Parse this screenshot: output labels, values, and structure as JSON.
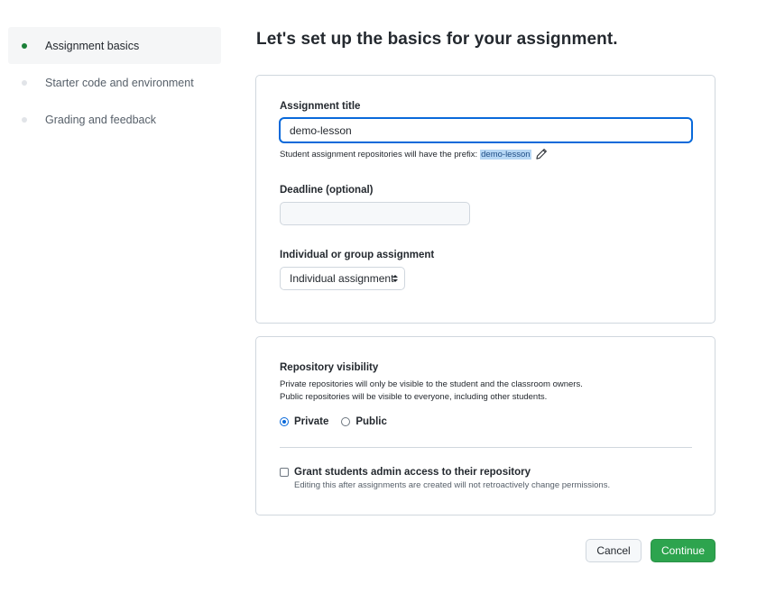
{
  "sidebar": {
    "items": [
      {
        "label": "Assignment basics",
        "active": true
      },
      {
        "label": "Starter code and environment",
        "active": false
      },
      {
        "label": "Grading and feedback",
        "active": false
      }
    ]
  },
  "main": {
    "title": "Let's set up the basics for your assignment."
  },
  "basics": {
    "title_label": "Assignment title",
    "title_value": "demo-lesson",
    "prefix_note": "Student assignment repositories will have the prefix:",
    "prefix_value": "demo-lesson",
    "deadline_label": "Deadline (optional)",
    "deadline_value": "",
    "type_label": "Individual or group assignment",
    "type_selected": "Individual assignment"
  },
  "visibility": {
    "label": "Repository visibility",
    "desc_private": "Private repositories will only be visible to the student and the classroom owners.",
    "desc_public": "Public repositories will be visible to everyone, including other students.",
    "option_private": "Private",
    "option_public": "Public",
    "selected": "Private",
    "admin_label": "Grant students admin access to their repository",
    "admin_desc": "Editing this after assignments are created will not retroactively change permissions.",
    "admin_checked": false
  },
  "actions": {
    "cancel_label": "Cancel",
    "continue_label": "Continue"
  },
  "colors": {
    "accent_green": "#2da44e",
    "active_dot": "#1a7f37",
    "focus_blue": "#0969da"
  }
}
